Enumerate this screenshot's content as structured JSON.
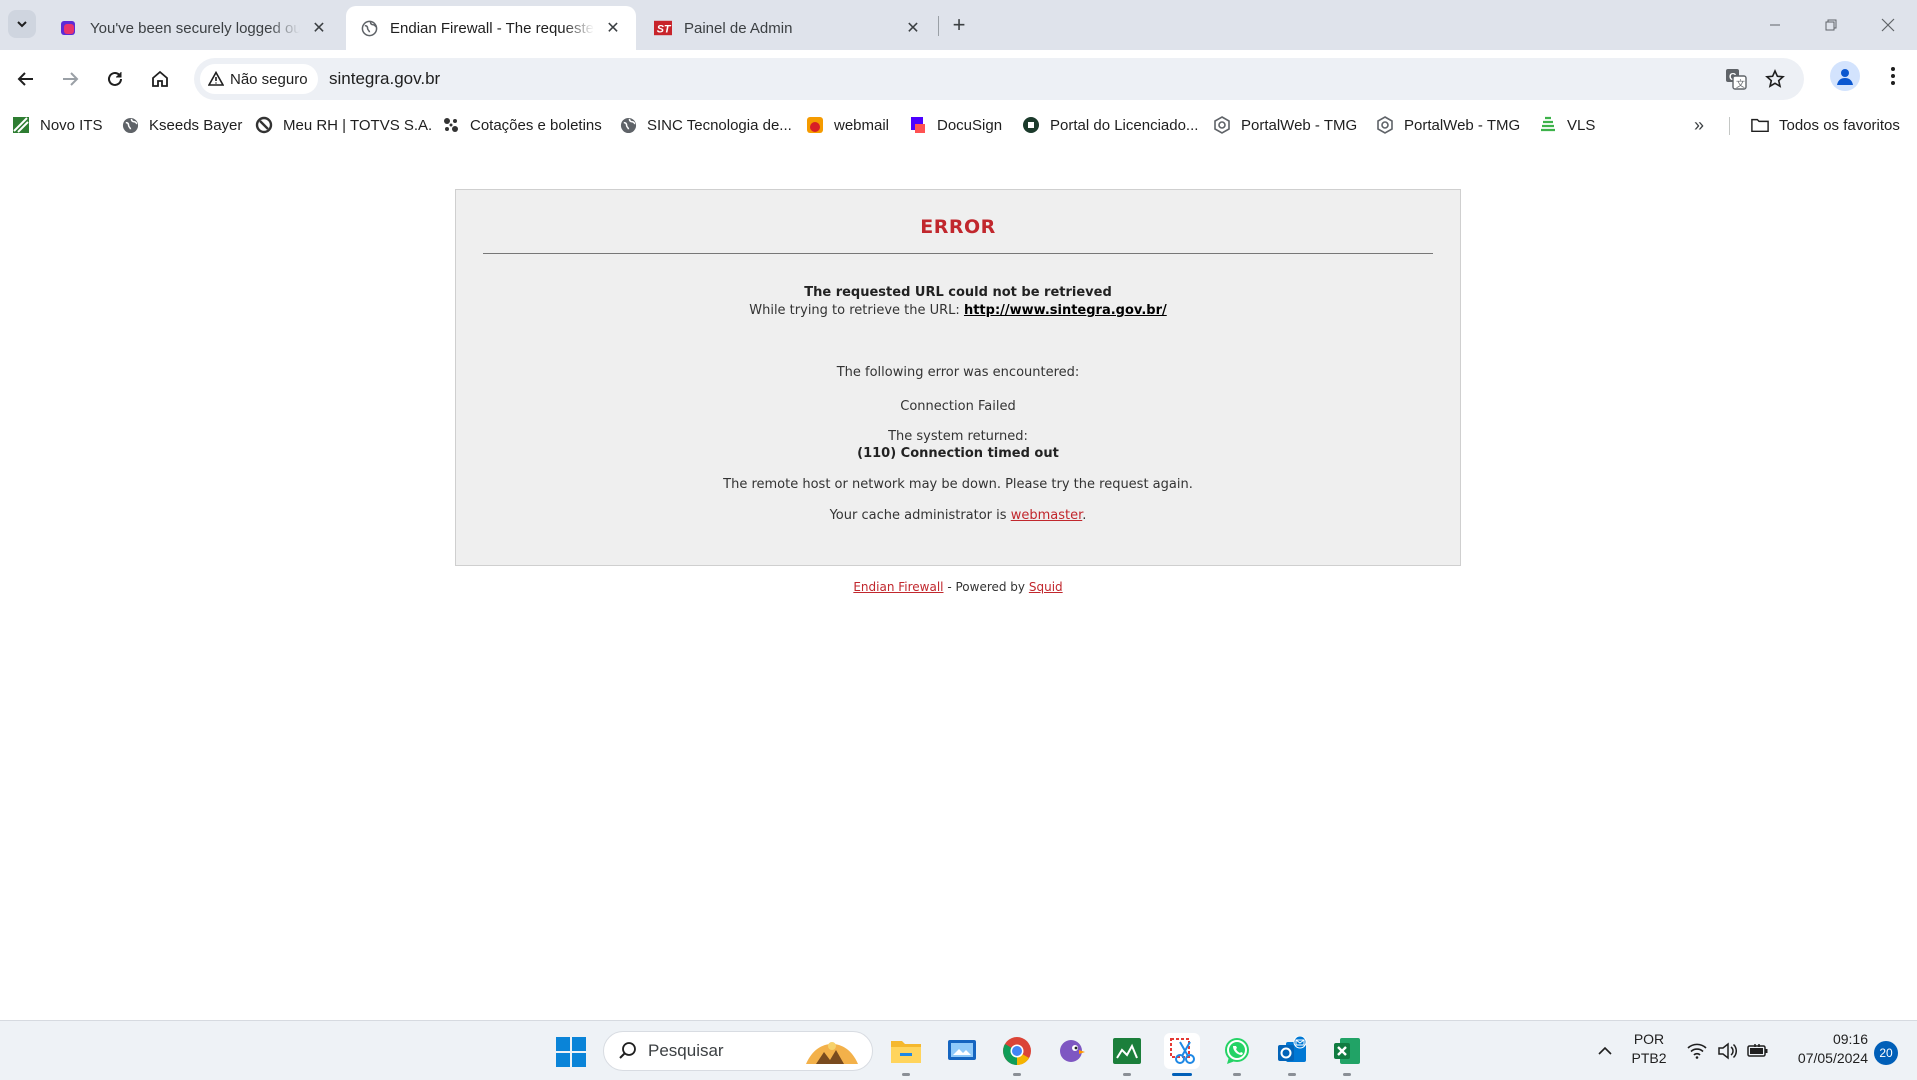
{
  "browser": {
    "tabs": [
      {
        "title": "You've been securely logged out",
        "icon": "purple-logo-icon",
        "active": false
      },
      {
        "title": "Endian Firewall - The requested URL could not be retrieved",
        "icon": "globe-icon",
        "active": true
      },
      {
        "title": "Painel de Admin",
        "icon": "st-logo-icon",
        "active": false
      }
    ],
    "security_chip": "Não seguro",
    "url": "sintegra.gov.br",
    "bookmarks": [
      {
        "label": "Novo ITS",
        "icon": "its-icon"
      },
      {
        "label": "Kseeds Bayer",
        "icon": "globe-icon"
      },
      {
        "label": "Meu RH | TOTVS S.A.",
        "icon": "totvs-icon"
      },
      {
        "label": "Cotações e boletins",
        "icon": "cotacoes-icon"
      },
      {
        "label": "SINC Tecnologia de...",
        "icon": "globe-icon"
      },
      {
        "label": "webmail",
        "icon": "webmail-icon"
      },
      {
        "label": "DocuSign",
        "icon": "docusign-icon"
      },
      {
        "label": "Portal do Licenciado...",
        "icon": "portal-icon"
      },
      {
        "label": "PortalWeb - TMG",
        "icon": "portalweb-icon"
      },
      {
        "label": "PortalWeb - TMG",
        "icon": "portalweb-icon"
      },
      {
        "label": "VLS",
        "icon": "vls-icon"
      }
    ],
    "all_bookmarks": "Todos os favoritos"
  },
  "page": {
    "heading": "ERROR",
    "subtitle": "The requested URL could not be retrieved",
    "trying_prefix": "While trying to retrieve the URL:",
    "trying_url": "http://www.sintegra.gov.br/",
    "encountered": "The following error was encountered:",
    "error_name": "Connection Failed",
    "system_returned": "The system returned:",
    "system_error": "(110) Connection timed out",
    "remote_msg": "The remote host or network may be down. Please try the request again.",
    "cache_prefix": "Your cache administrator is",
    "cache_admin": "webmaster",
    "cache_suffix": ".",
    "footer": {
      "endian": "Endian Firewall",
      "powered": "- Powered by",
      "squid": "Squid"
    }
  },
  "taskbar": {
    "search_placeholder": "Pesquisar",
    "language": "POR",
    "keyboard": "PTB2",
    "time": "09:16",
    "date": "07/05/2024",
    "notifications": "20"
  },
  "colors": {
    "accent_red": "#c1272d",
    "tabstrip": "#dfe3eb",
    "taskbar_accent": "#005fb8"
  }
}
